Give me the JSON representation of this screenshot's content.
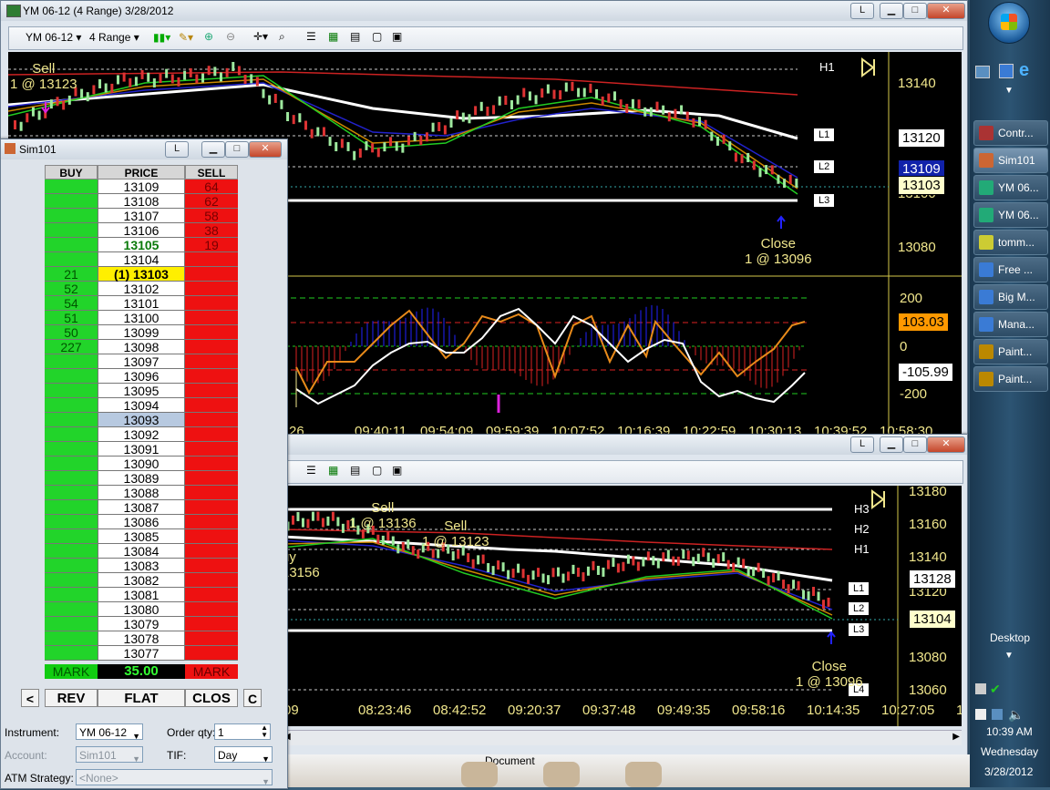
{
  "main_window": {
    "title": "YM 06-12 (4 Range)  3/28/2012",
    "instrument": "YM 06-12",
    "period": "4 Range",
    "restore_label": "L"
  },
  "top_chart": {
    "y_labels": [
      "13140",
      "13120",
      "13100",
      "13080"
    ],
    "price_boxes": {
      "l1": "13120",
      "last": "13109",
      "close": "13103"
    },
    "levels": [
      "H1",
      "L1",
      "L2",
      "L3"
    ],
    "sell_annotation": [
      "Sell",
      "1 @ 13123"
    ],
    "close_annotation": [
      "Close",
      "1 @ 13096"
    ],
    "osc_y_labels": [
      "200",
      "0",
      "-200"
    ],
    "osc_boxes": {
      "upper": "103.03",
      "lower": "-105.99"
    },
    "x_labels": [
      "26",
      "09:40:11",
      "09:54:09",
      "09:59:39",
      "10:07:52",
      "10:16:39",
      "10:22:59",
      "10:30:13",
      "10:39:52",
      "10:58:30"
    ]
  },
  "bottom_chart": {
    "y_labels": [
      "13180",
      "13160",
      "13140",
      "13120",
      "13100",
      "13080",
      "13060"
    ],
    "price_boxes": {
      "l1": "13128",
      "last": "13104"
    },
    "levels": [
      "H3",
      "H2",
      "H1",
      "L1",
      "L2",
      "L3",
      "L4"
    ],
    "sell1": [
      "Sell",
      "1 @ 13136"
    ],
    "sell2": [
      "Sell",
      "1 @ 13123"
    ],
    "buy": [
      "uy",
      "13156"
    ],
    "close_annotation": [
      "Close",
      "1 @ 13096"
    ],
    "x_labels": [
      "09",
      "08:23:46",
      "08:42:52",
      "09:20:37",
      "09:37:48",
      "09:49:35",
      "09:58:16",
      "10:14:35",
      "10:27:05",
      "10:49:14"
    ],
    "taskbar_label": "Document"
  },
  "dom_window": {
    "title": "Sim101",
    "headers": {
      "buy": "BUY",
      "price": "PRICE",
      "sell": "SELL"
    },
    "rows": [
      {
        "buy": "",
        "price": "13109",
        "sell": "64"
      },
      {
        "buy": "",
        "price": "13108",
        "sell": "62"
      },
      {
        "buy": "",
        "price": "13107",
        "sell": "58"
      },
      {
        "buy": "",
        "price": "13106",
        "sell": "38"
      },
      {
        "buy": "",
        "price": "13105",
        "sell": "19"
      },
      {
        "buy": "",
        "price": "13104",
        "sell": ""
      },
      {
        "buy": "21",
        "price": "(1) 13103",
        "sell": ""
      },
      {
        "buy": "52",
        "price": "13102",
        "sell": ""
      },
      {
        "buy": "54",
        "price": "13101",
        "sell": ""
      },
      {
        "buy": "51",
        "price": "13100",
        "sell": ""
      },
      {
        "buy": "50",
        "price": "13099",
        "sell": ""
      },
      {
        "buy": "227",
        "price": "13098",
        "sell": ""
      },
      {
        "buy": "",
        "price": "13097",
        "sell": ""
      },
      {
        "buy": "",
        "price": "13096",
        "sell": ""
      },
      {
        "buy": "",
        "price": "13095",
        "sell": ""
      },
      {
        "buy": "",
        "price": "13094",
        "sell": ""
      },
      {
        "buy": "",
        "price": "13093",
        "sell": ""
      },
      {
        "buy": "",
        "price": "13092",
        "sell": ""
      },
      {
        "buy": "",
        "price": "13091",
        "sell": ""
      },
      {
        "buy": "",
        "price": "13090",
        "sell": ""
      },
      {
        "buy": "",
        "price": "13089",
        "sell": ""
      },
      {
        "buy": "",
        "price": "13088",
        "sell": ""
      },
      {
        "buy": "",
        "price": "13087",
        "sell": ""
      },
      {
        "buy": "",
        "price": "13086",
        "sell": ""
      },
      {
        "buy": "",
        "price": "13085",
        "sell": ""
      },
      {
        "buy": "",
        "price": "13084",
        "sell": ""
      },
      {
        "buy": "",
        "price": "13083",
        "sell": ""
      },
      {
        "buy": "",
        "price": "13082",
        "sell": ""
      },
      {
        "buy": "",
        "price": "13081",
        "sell": ""
      },
      {
        "buy": "",
        "price": "13080",
        "sell": ""
      },
      {
        "buy": "",
        "price": "13079",
        "sell": ""
      },
      {
        "buy": "",
        "price": "13078",
        "sell": ""
      },
      {
        "buy": "",
        "price": "13077",
        "sell": ""
      }
    ],
    "mark_left": "MARK",
    "mark_value": "35.00",
    "mark_right": "MARK",
    "buttons": {
      "left": "<",
      "rev": "REV",
      "flat": "FLAT",
      "clos": "CLOS",
      "c": "C"
    },
    "instrument_label": "Instrument:",
    "instrument_value": "YM 06-12",
    "order_qty_label": "Order qty:",
    "order_qty_value": "1",
    "account_label": "Account:",
    "account_value": "Sim101",
    "tif_label": "TIF:",
    "tif_value": "Day",
    "atm_label": "ATM Strategy:",
    "atm_value": "<None>"
  },
  "taskbar": {
    "items": [
      "Contr...",
      "Sim101",
      "YM 06...",
      "YM 06...",
      "tomm...",
      "Free ...",
      "Big M...",
      "Mana...",
      "Paint...",
      "Paint..."
    ],
    "desktop_label": "Desktop",
    "time": "10:39 AM",
    "day": "Wednesday",
    "date": "3/28/2012"
  }
}
